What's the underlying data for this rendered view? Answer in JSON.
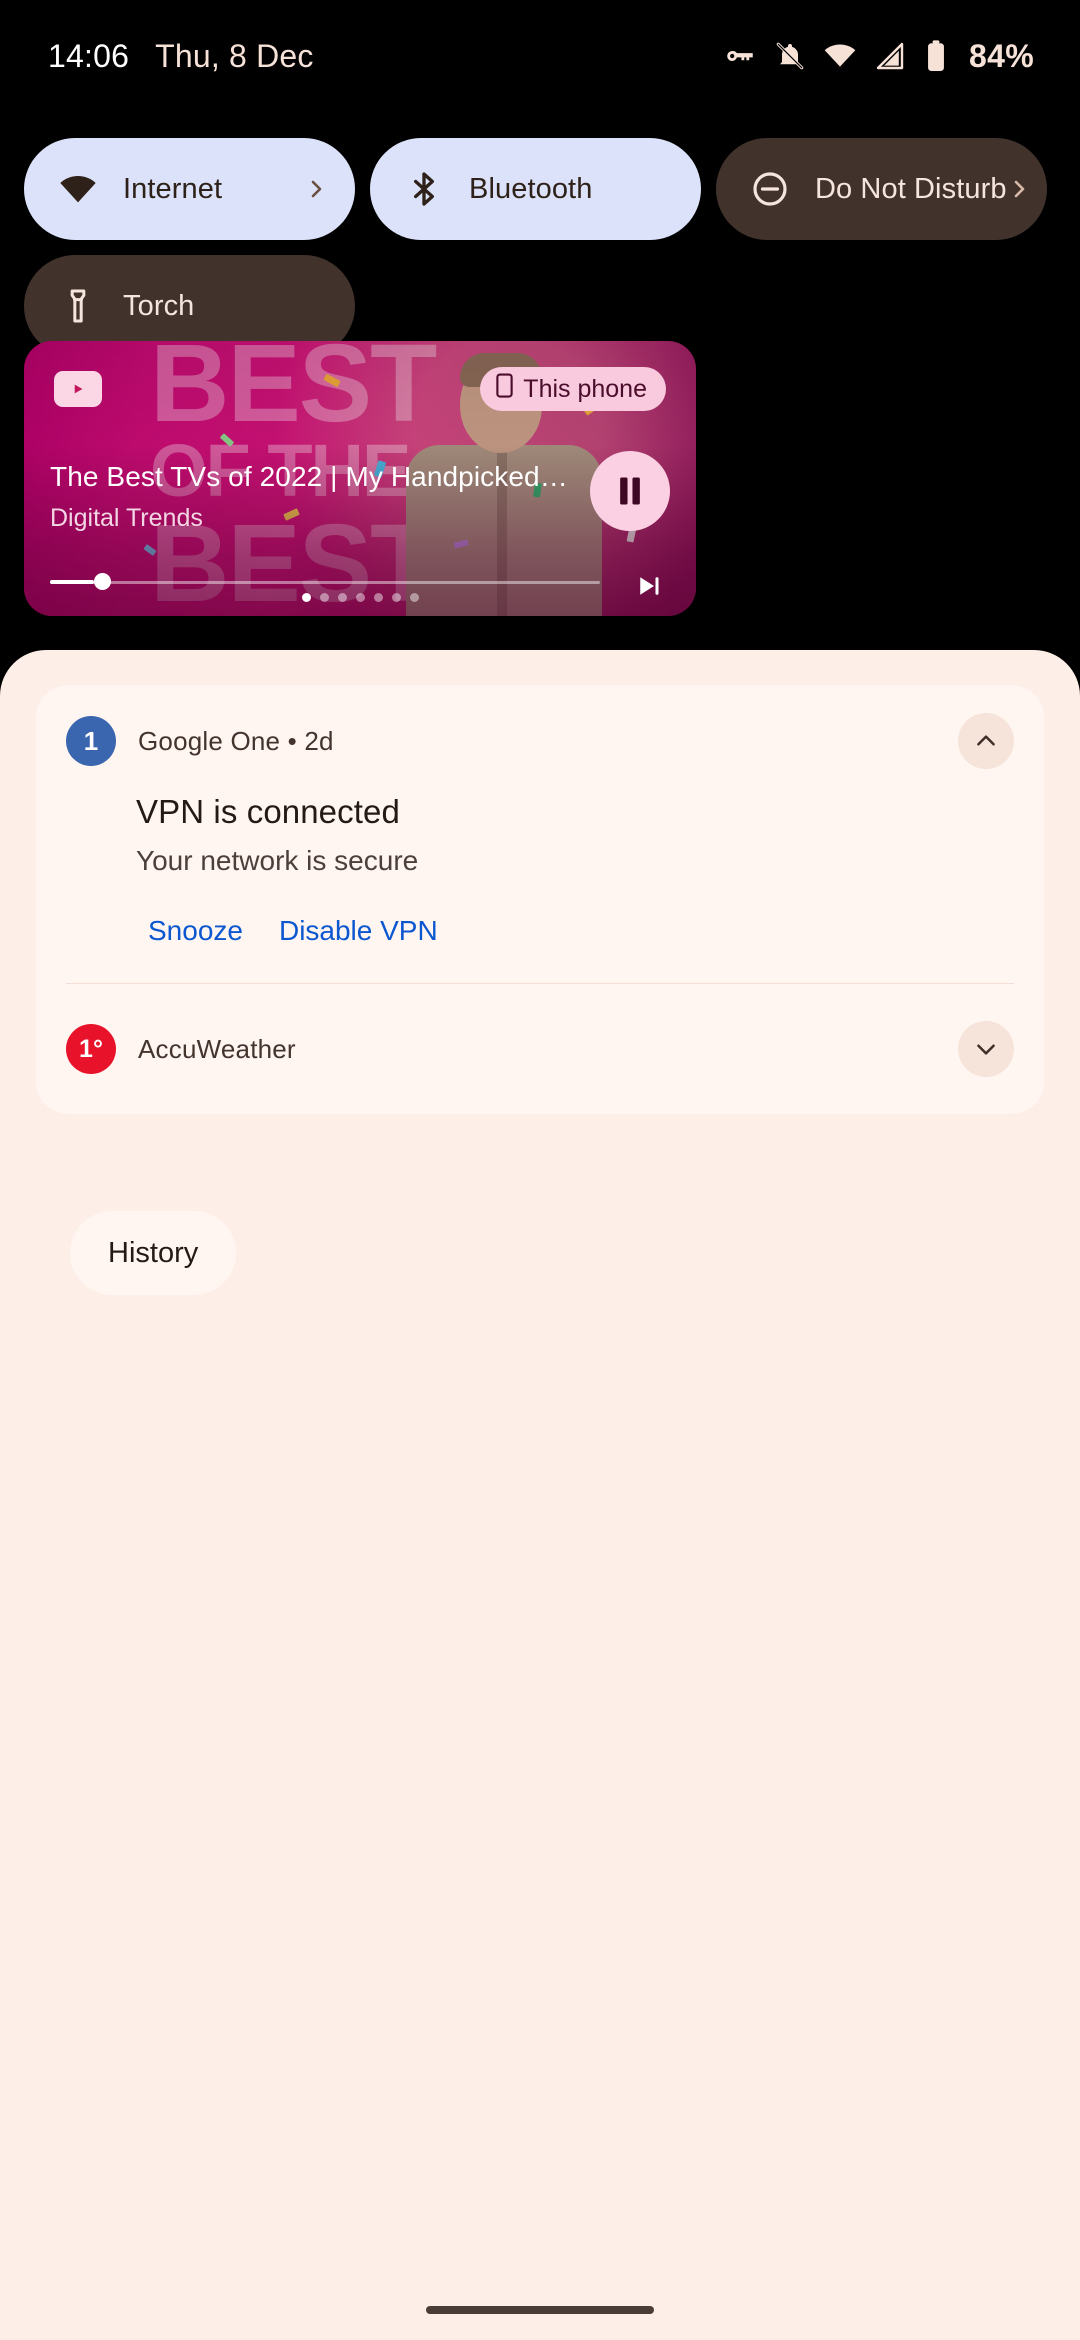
{
  "status_bar": {
    "clock": "14:06",
    "date": "Thu, 8 Dec",
    "battery_percent": "84%",
    "icons": [
      "vpn-key-icon",
      "notifications-off-icon",
      "wifi-icon",
      "cellular-signal-icon",
      "battery-icon"
    ],
    "text_color": "#f7e2d8"
  },
  "quick_settings": {
    "tiles": [
      {
        "label": "Internet",
        "icon": "wifi-icon",
        "state": "on",
        "has_chevron": true
      },
      {
        "label": "Bluetooth",
        "icon": "bluetooth-icon",
        "state": "on",
        "has_chevron": false
      },
      {
        "label": "Do Not Disturb",
        "icon": "dnd-icon",
        "state": "off",
        "has_chevron": true
      },
      {
        "label": "Torch",
        "icon": "flashlight-icon",
        "state": "off",
        "has_chevron": false
      }
    ],
    "active_color": "#dbe2f9",
    "inactive_color": "#41332c"
  },
  "media_player": {
    "app_icon": "youtube-icon",
    "device_chip": {
      "label": "This phone",
      "icon": "phone-icon",
      "color": "#f9c9dd"
    },
    "title": "The Best TVs of 2022 | My Handpicked Favorit…",
    "artist": "Digital Trends",
    "artwork_text": [
      "BEST",
      "OF THE",
      "BEST"
    ],
    "play_state": "playing",
    "play_button_icon": "pause-icon",
    "next_button_icon": "skip-next-icon",
    "progress_percent": 7,
    "pager": {
      "count": 7,
      "active_index": 0
    },
    "accent_color": "#c81278"
  },
  "notifications": {
    "panel_color": "#fdeee7",
    "items": [
      {
        "app": "Google One • 2d",
        "avatar_text": "1",
        "avatar_color": "#3a66b0",
        "title": "VPN is connected",
        "body": "Your network is secure",
        "actions": [
          "Snooze",
          "Disable VPN"
        ],
        "action_color": "#0b57d0",
        "expand_icon": "chevron-up-icon",
        "expanded": true
      },
      {
        "app": "AccuWeather",
        "avatar_text": "1°",
        "avatar_color": "#e8132a",
        "expand_icon": "chevron-down-icon",
        "expanded": false
      }
    ],
    "history_label": "History"
  }
}
